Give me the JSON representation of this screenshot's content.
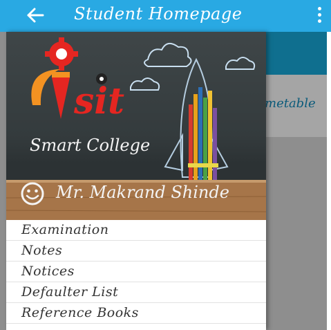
{
  "appbar": {
    "title": "Student Homepage",
    "back_icon": "back-arrow-icon",
    "more_icon": "more-vert-icon"
  },
  "background": {
    "card_label": "metable"
  },
  "drawer": {
    "logo_text": "isit",
    "tagline": "Smart College",
    "user_icon": "smiley-icon",
    "user_name": "Mr. Makrand Shinde",
    "menu": [
      {
        "label": "Examination"
      },
      {
        "label": "Notes"
      },
      {
        "label": "Notices"
      },
      {
        "label": "Defaulter List"
      },
      {
        "label": "Reference Books"
      }
    ]
  },
  "colors": {
    "appbar": "#29A9E3",
    "accent": "#0f6f8f",
    "logo_red": "#e52621",
    "logo_orange": "#f39222"
  }
}
